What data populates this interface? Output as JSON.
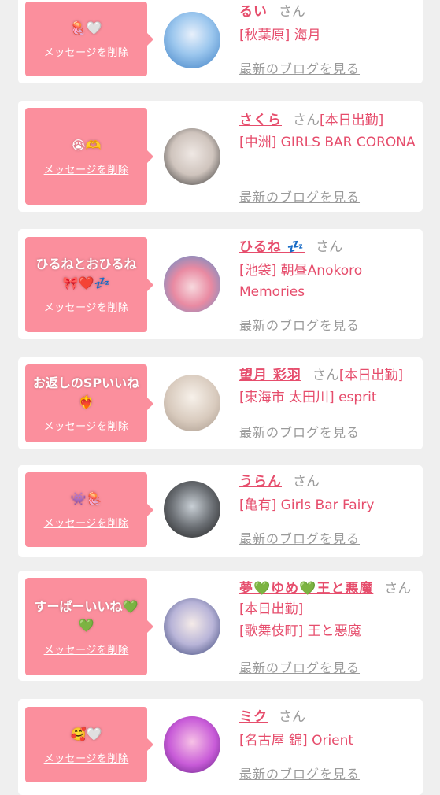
{
  "delete_label": "メッセージを削除",
  "blog_label": "最新のブログを見る",
  "san_label": "さん",
  "accent_color": "#fb8f9d",
  "name_color": "#e64d6c",
  "entries": [
    {
      "message": "🪼🤍",
      "name": "るい",
      "status": "",
      "shop": "[秋葉原] 海月",
      "avatar_colors": [
        "#6fb6e6",
        "#e8f0fb"
      ]
    },
    {
      "message": "😭🫶",
      "name": "さくら",
      "status": "[本日出勤]",
      "shop": "[中洲] GIRLS BAR CORONA",
      "avatar_colors": [
        "#d8d0cc",
        "#2b2b2b"
      ]
    },
    {
      "message": "ひるねとおひるね\n🎀❤️💤",
      "name": "ひるね 💤",
      "status": "",
      "shop": "[池袋] 朝昼Anokoro Memories",
      "avatar_colors": [
        "#f3b3c2",
        "#5aa0d8"
      ]
    },
    {
      "message": "お返しのSPいいね\n❤️‍🔥",
      "name": "望月 彩羽",
      "status": "[本日出勤]",
      "shop": "[東海市 太田川] esprit",
      "avatar_colors": [
        "#d9cfc6",
        "#f4ede6"
      ]
    },
    {
      "message": "👾🪼",
      "name": "うらん",
      "status": "",
      "shop": "[亀有] Girls Bar Fairy",
      "avatar_colors": [
        "#3a3a3a",
        "#bfc6cc"
      ]
    },
    {
      "message": "すーぱーいいね💚\n💚",
      "name": "夢💚ゆめ💚王と悪魔",
      "status": "[本日出勤]",
      "shop": "[歌舞伎町] 王と悪魔",
      "avatar_colors": [
        "#5b6fb5",
        "#f1e6e4"
      ]
    },
    {
      "message": "🥰🤍",
      "name": "ミク",
      "status": "",
      "shop": "[名古屋 錦] Orient",
      "avatar_colors": [
        "#b04ad0",
        "#f4a0d8"
      ]
    }
  ]
}
